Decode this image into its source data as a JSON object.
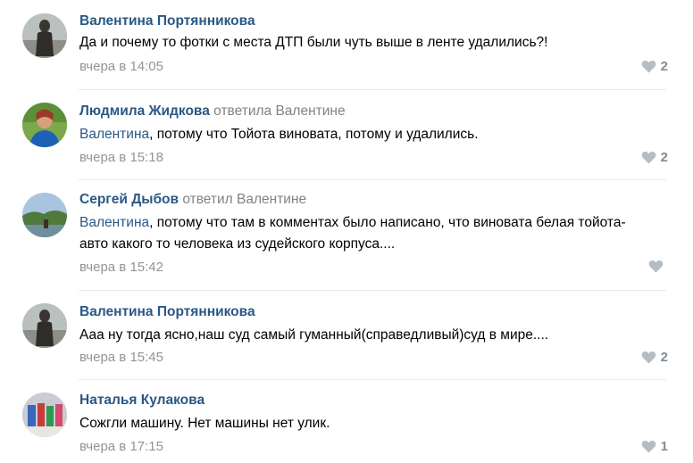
{
  "comments": [
    {
      "author": "Валентина Портянникова",
      "reply_to": "",
      "mention": "",
      "text": "Да и почему то фотки с места ДТП были чуть выше в ленте удалились?!",
      "date": "вчера в 14:05",
      "likes": "2",
      "avatar": "woman-standing-photo"
    },
    {
      "author": "Людмила Жидкова",
      "reply_to": "ответила Валентине",
      "mention": "Валентина",
      "text": ", потому что Тойота виновата, потому и удалились.",
      "date": "вчера в 15:18",
      "likes": "2",
      "avatar": "woman-portrait-photo"
    },
    {
      "author": "Сергей Дыбов",
      "reply_to": "ответил Валентине",
      "mention": "Валентина",
      "text": ", потому что там в комментах было написано, что виновата белая тойота- авто какого то человека из судейского корпуса....",
      "date": "вчера в 15:42",
      "likes": "",
      "avatar": "landscape-photo"
    },
    {
      "author": "Валентина Портянникова",
      "reply_to": "",
      "mention": "",
      "text": "Ааа ну тогда ясно,наш суд самый гуманный(справедливый)суд в мире....",
      "date": "вчера в 15:45",
      "likes": "2",
      "avatar": "woman-standing-photo"
    },
    {
      "author": "Наталья Кулакова",
      "reply_to": "",
      "mention": "",
      "text": "Сожгли машину. Нет машины нет улик.",
      "date": "вчера в 17:15",
      "likes": "1",
      "avatar": "group-photo"
    }
  ],
  "colors": {
    "author": "#2a5885",
    "muted": "#828282",
    "date": "#939393",
    "heart": "#b5bcc4",
    "divider": "#e7e8ec"
  }
}
